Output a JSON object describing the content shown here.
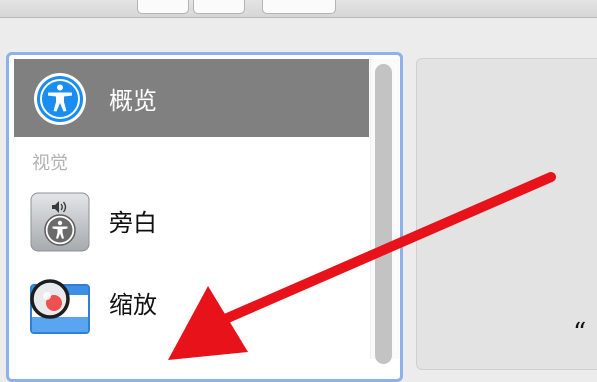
{
  "sidebar": {
    "items": [
      {
        "label": "概览",
        "icon": "accessibility-icon",
        "selected": true
      },
      {
        "label": "旁白",
        "icon": "voiceover-icon",
        "selected": false
      },
      {
        "label": "缩放",
        "icon": "zoom-icon",
        "selected": false
      }
    ],
    "section_label": "视觉"
  },
  "detail": {
    "partial_text": "“"
  },
  "colors": {
    "selection": "#808080",
    "focus_ring": "#8fb0ea",
    "arrow": "#e8121a",
    "accessibility_blue": "#1a8df0"
  }
}
